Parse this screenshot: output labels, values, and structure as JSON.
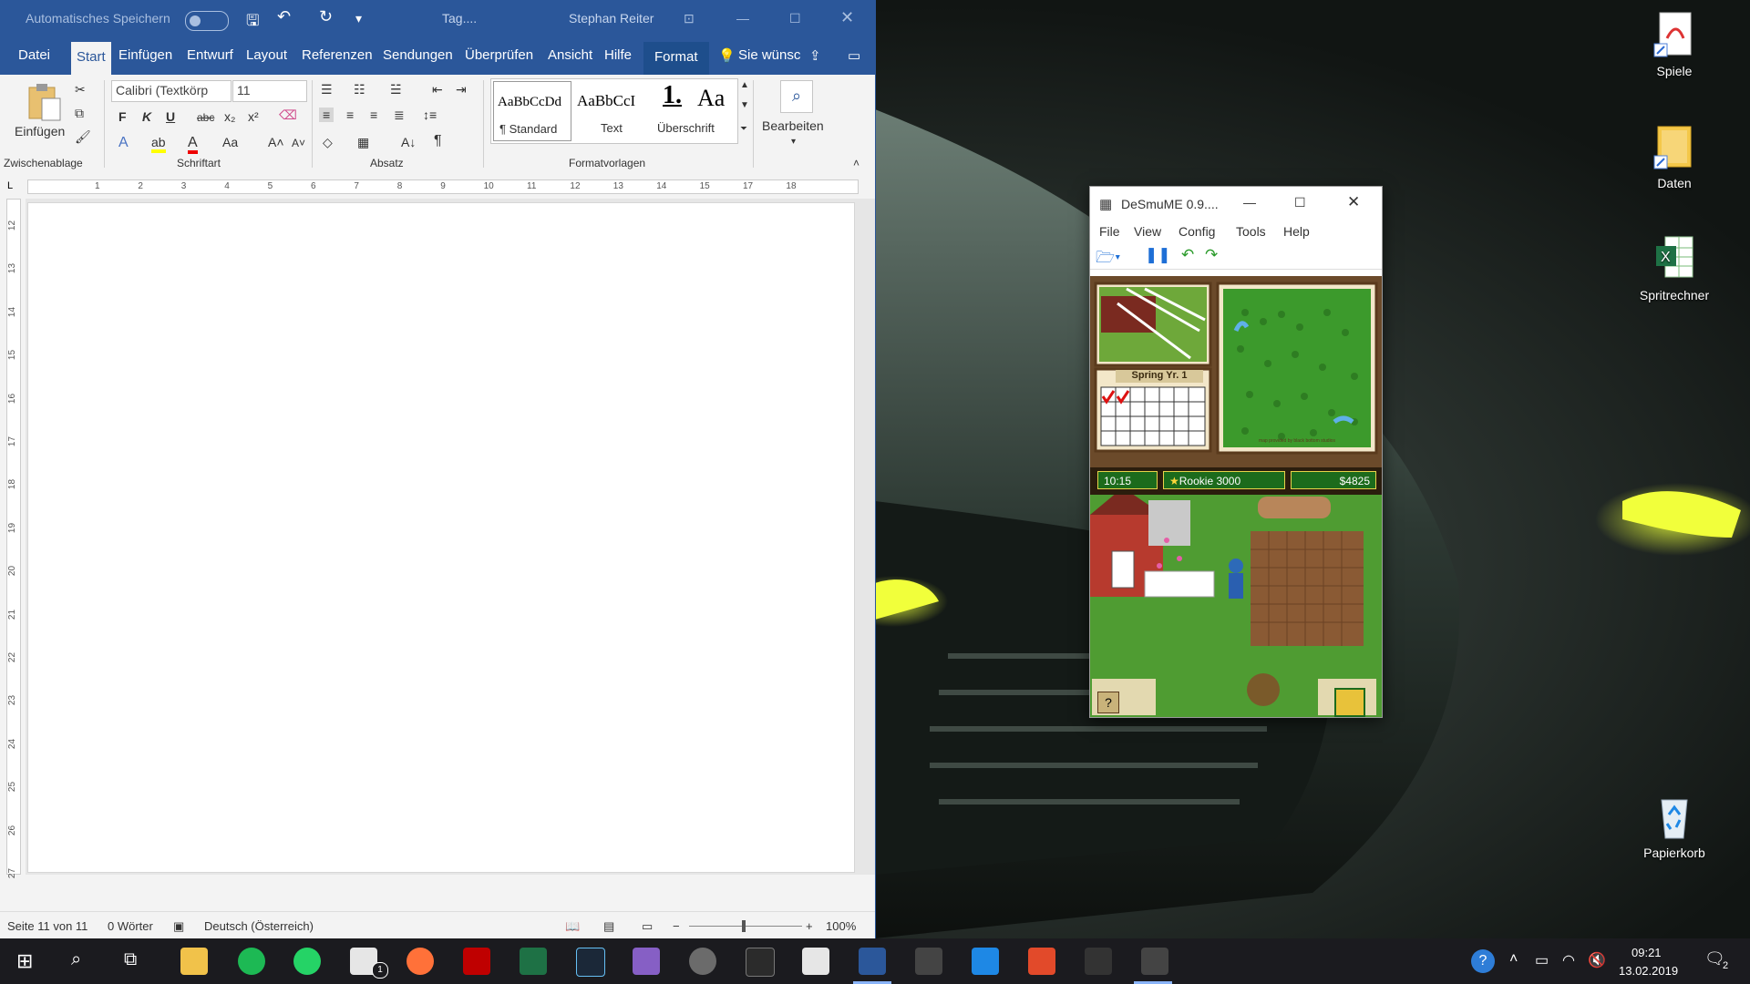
{
  "word": {
    "titlebar": {
      "autosave_label": "Automatisches Speichern",
      "doc_title": "Tag....",
      "user": "Stephan Reiter"
    },
    "tabs": [
      "Datei",
      "Start",
      "Einfügen",
      "Entwurf",
      "Layout",
      "Referenzen",
      "Sendungen",
      "Überprüfen",
      "Ansicht",
      "Hilfe",
      "Format"
    ],
    "tell_me": "Sie wünsc",
    "clipboard": {
      "paste_label": "Einfügen",
      "group_label": "Zwischenablage"
    },
    "font": {
      "name": "Calibri (Textkörp",
      "size": "11",
      "group_label": "Schriftart",
      "bold": "F",
      "italic": "K",
      "underline": "U",
      "strike": "abc"
    },
    "paragraph": {
      "group_label": "Absatz",
      "pilcrow": "¶"
    },
    "styles": {
      "group_label": "Formatvorlagen",
      "items": [
        {
          "preview": "AaBbCcDd",
          "name": "¶ Standard"
        },
        {
          "preview": "AaBbCcI",
          "name": "Text"
        },
        {
          "preview": "1.",
          "name": "Überschrift"
        },
        {
          "preview": "Aa",
          "name": ""
        }
      ]
    },
    "editing": {
      "label": "Bearbeiten"
    },
    "ruler_h": [
      "1",
      "2",
      "3",
      "4",
      "5",
      "6",
      "7",
      "8",
      "9",
      "10",
      "11",
      "12",
      "13",
      "14",
      "15",
      "17",
      "18"
    ],
    "ruler_v": [
      "12",
      "13",
      "14",
      "15",
      "16",
      "17",
      "18",
      "19",
      "20",
      "21",
      "22",
      "23",
      "24",
      "25",
      "26",
      "27"
    ],
    "status": {
      "page": "Seite 11 von 11",
      "words": "0 Wörter",
      "language": "Deutsch (Österreich)",
      "zoom": "100%"
    }
  },
  "desmume": {
    "title": "DeSmuME 0.9....",
    "menu": [
      "File",
      "View",
      "Config",
      "Tools",
      "Help"
    ],
    "game": {
      "calendar_title": "Spring  Yr. 1",
      "time": "10:15",
      "rank": "Rookie  3000",
      "money": "$4825",
      "map_credit": "map provided by black bottom studios"
    }
  },
  "desktop_icons": [
    {
      "label": "Spiele"
    },
    {
      "label": "Daten"
    },
    {
      "label": "Spritrechner"
    },
    {
      "label": "Papierkorb"
    }
  ],
  "taskbar": {
    "clock_time": "09:21",
    "clock_date": "13.02.2019",
    "notification_count": "2",
    "mail_badge": "1"
  }
}
